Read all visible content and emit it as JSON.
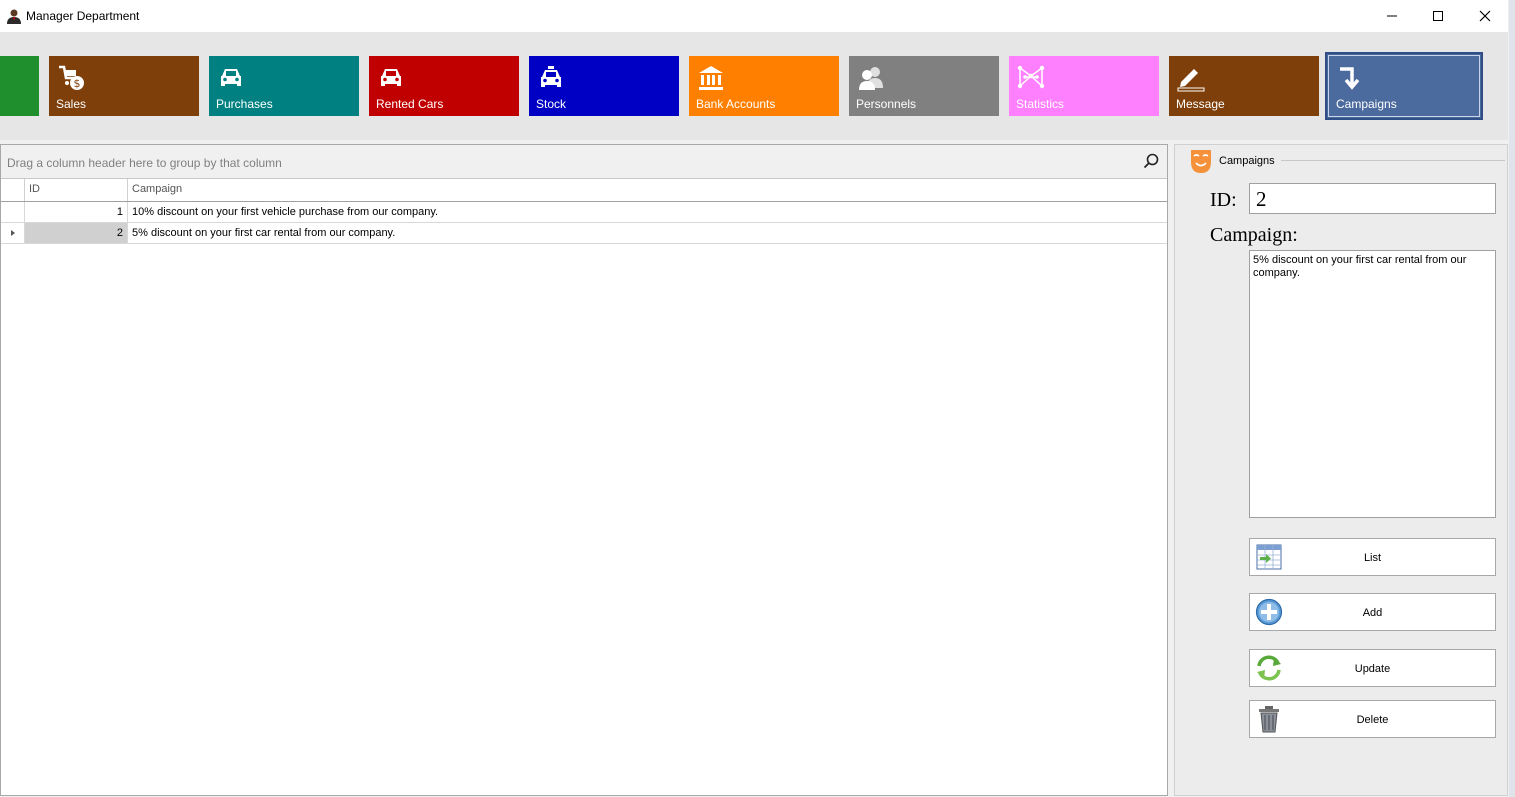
{
  "window": {
    "title": "Manager Department",
    "minimize_icon": "minimize-icon",
    "maximize_icon": "maximize-icon",
    "close_icon": "close-icon"
  },
  "tiles": [
    {
      "label": "",
      "color": "#1f8f2d",
      "icon": "none"
    },
    {
      "label": "Sales",
      "color": "#7e3f0a",
      "icon": "cart-dollar-icon"
    },
    {
      "label": "Purchases",
      "color": "#008080",
      "icon": "car-icon"
    },
    {
      "label": "Rented Cars",
      "color": "#c00000",
      "icon": "car-icon"
    },
    {
      "label": "Stock",
      "color": "#0000c4",
      "icon": "taxi-icon"
    },
    {
      "label": "Bank Accounts",
      "color": "#ff8000",
      "icon": "bank-icon"
    },
    {
      "label": "Personnels",
      "color": "#808080",
      "icon": "people-icon"
    },
    {
      "label": "Statistics",
      "color": "#ff80ff",
      "icon": "network-icon"
    },
    {
      "label": "Message",
      "color": "#7e3f0a",
      "icon": "pencil-icon"
    },
    {
      "label": "Campaigns",
      "color": "#4b6a9d",
      "icon": "arrow-turn-down-icon",
      "selected": true
    }
  ],
  "grid": {
    "group_panel_text": "Drag a column header here to group by that column",
    "columns": [
      "ID",
      "Campaign"
    ],
    "rows": [
      {
        "id": "1",
        "campaign": "10% discount on your first vehicle purchase from our company."
      },
      {
        "id": "2",
        "campaign": "5% discount on your first car rental from our company.",
        "focused": true
      }
    ]
  },
  "form": {
    "group_title": "Campaigns",
    "id_label": "ID:",
    "id_value": "2",
    "campaign_label": "Campaign:",
    "campaign_value": "5% discount on your first car rental from our company.",
    "buttons": {
      "list": "List",
      "add": "Add",
      "update": "Update",
      "delete": "Delete"
    }
  }
}
